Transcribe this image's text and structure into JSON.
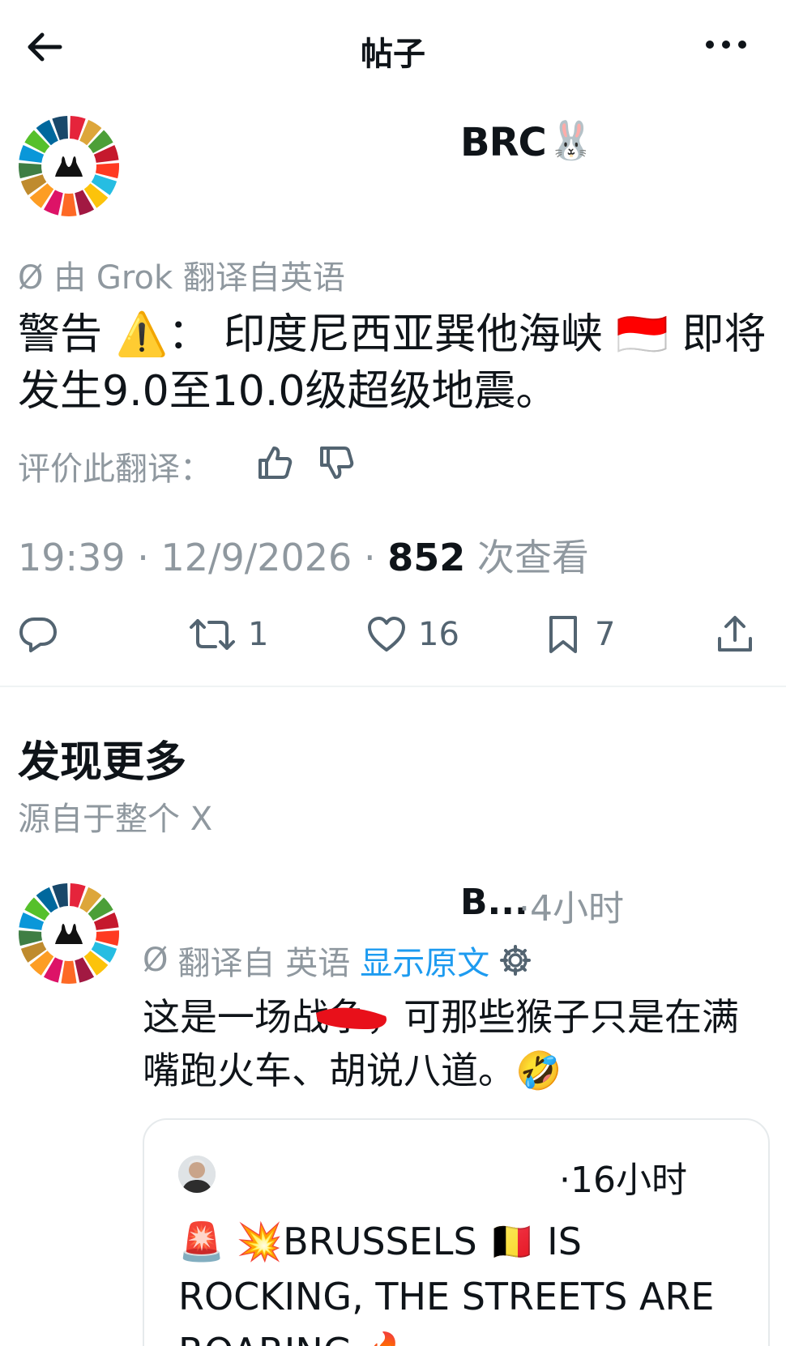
{
  "header": {
    "back_icon": "arrow-left-icon",
    "title": "帖子",
    "more_icon": "more-horizontal-icon"
  },
  "post": {
    "author_name": "BRC",
    "author_emoji": "🐰",
    "translate_note": "由 Grok 翻译自英语",
    "text": "警告 ⚠️： 印度尼西亚巽他海峡 🇮🇩 即将发生9.0至10.0级超级地震。",
    "rate_translation": "评价此翻译：",
    "time": "19:39",
    "date": "12/9/2026",
    "views_count": "852",
    "views_label": "次查看",
    "actions": {
      "reply": "",
      "retweets": "1",
      "likes": "16",
      "bookmarks": "7"
    }
  },
  "discover": {
    "title": "发现更多",
    "subtitle": "源自于整个 X"
  },
  "recommended": {
    "author_name": "B...",
    "time": "·4小时",
    "translate_label": "翻译自 英语",
    "show_original": "显示原文",
    "text": "这是一场战争，可那些猴子只是在满嘴跑火车、胡说八道。🤣",
    "quote": {
      "time": "·16小时",
      "text": "🚨 💥BRUSSELS 🇧🇪 IS ROCKING, THE STREETS ARE ROARING 🔥"
    }
  },
  "colors": {
    "text": "#0f1419",
    "secondary": "#8f989f",
    "link": "#1d9bf0",
    "divider": "#eff3f4"
  }
}
